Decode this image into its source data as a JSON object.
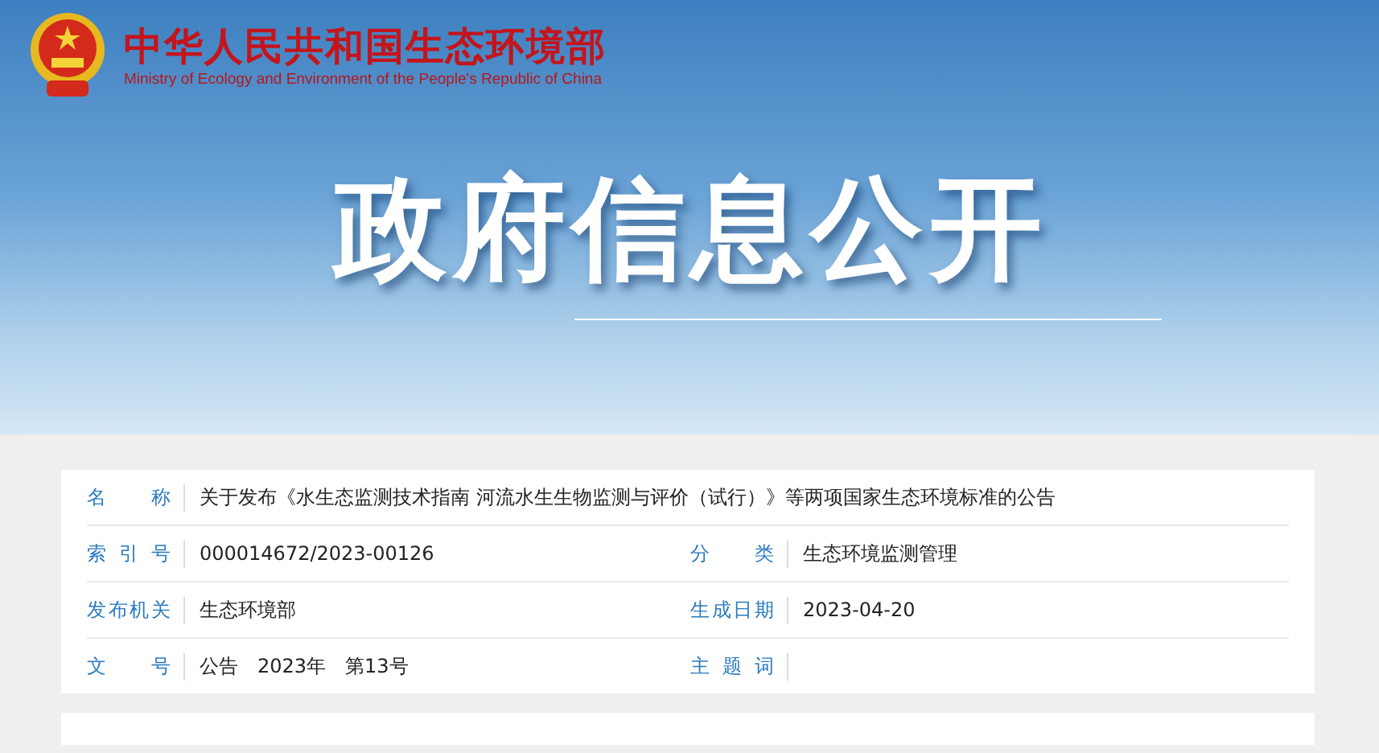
{
  "header": {
    "title": "中华人民共和国生态环境部",
    "subtitle": "Ministry of Ecology and Environment of the People's Republic of China"
  },
  "banner": {
    "title": "政府信息公开"
  },
  "info": [
    [
      {
        "label": "名 称",
        "value": "关于发布《水生态监测技术指南 河流水生生物监测与评价（试行）》等两项国家生态环境标准的公告"
      }
    ],
    [
      {
        "label": "索 引 号",
        "value": "000014672/2023-00126"
      },
      {
        "label": "分 类",
        "value": "生态环境监测管理"
      }
    ],
    [
      {
        "label": "发布机关",
        "value": "生态环境部"
      },
      {
        "label": "生成日期",
        "value": "2023-04-20"
      }
    ],
    [
      {
        "label": "文 号",
        "value": "公告　2023年　第13号"
      },
      {
        "label": "主 题 词"
      }
    ]
  ]
}
